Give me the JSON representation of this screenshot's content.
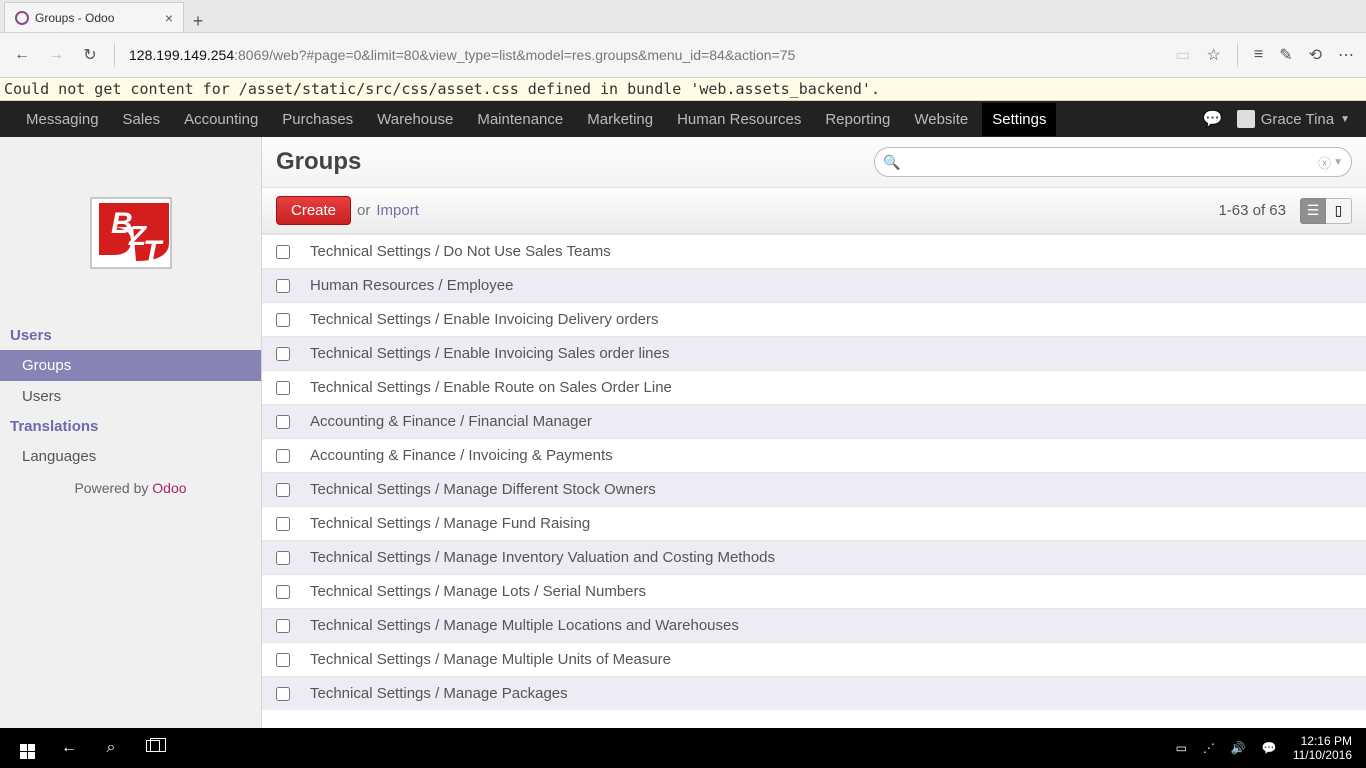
{
  "browser": {
    "tab_title": "Groups - Odoo",
    "url_bold": "128.199.149.254",
    "url_rest": ":8069/web?#page=0&limit=80&view_type=list&model=res.groups&menu_id=84&action=75"
  },
  "warning": "Could not get content for /asset/static/src/css/asset.css defined in bundle 'web.assets_backend'.",
  "topnav": {
    "items": [
      "Messaging",
      "Sales",
      "Accounting",
      "Purchases",
      "Warehouse",
      "Maintenance",
      "Marketing",
      "Human Resources",
      "Reporting",
      "Website",
      "Settings"
    ],
    "active_index": 10,
    "user": "Grace Tina"
  },
  "sidebar": {
    "section_users": "Users",
    "item_groups": "Groups",
    "item_users": "Users",
    "section_translations": "Translations",
    "item_languages": "Languages",
    "powered_by": "Powered by ",
    "powered_link": "Odoo"
  },
  "header": {
    "title": "Groups",
    "search_placeholder": ""
  },
  "toolbar": {
    "create": "Create",
    "or": "or",
    "import": "Import",
    "pager": "1-63 of 63"
  },
  "rows": [
    "Technical Settings / Do Not Use Sales Teams",
    "Human Resources / Employee",
    "Technical Settings / Enable Invoicing Delivery orders",
    "Technical Settings / Enable Invoicing Sales order lines",
    "Technical Settings / Enable Route on Sales Order Line",
    "Accounting & Finance / Financial Manager",
    "Accounting & Finance / Invoicing & Payments",
    "Technical Settings / Manage Different Stock Owners",
    "Technical Settings / Manage Fund Raising",
    "Technical Settings / Manage Inventory Valuation and Costing Methods",
    "Technical Settings / Manage Lots / Serial Numbers",
    "Technical Settings / Manage Multiple Locations and Warehouses",
    "Technical Settings / Manage Multiple Units of Measure",
    "Technical Settings / Manage Packages"
  ],
  "taskbar": {
    "time": "12:16 PM",
    "date": "11/10/2016"
  }
}
